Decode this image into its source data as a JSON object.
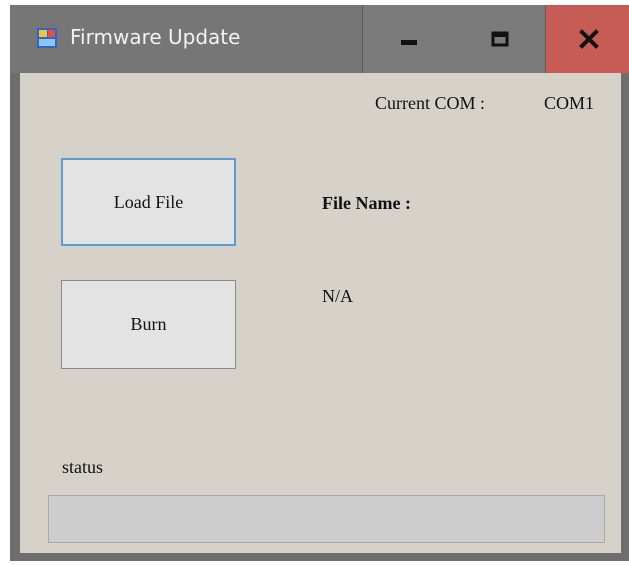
{
  "window": {
    "title": "Firmware Update",
    "controls": {
      "minimize": "minimize",
      "maximize": "maximize",
      "close": "close"
    }
  },
  "com": {
    "label": "Current COM :",
    "value": "COM1"
  },
  "buttons": {
    "load_file": "Load File",
    "burn": "Burn"
  },
  "file": {
    "label": "File Name :",
    "value": "N/A"
  },
  "status": {
    "label": "status",
    "progress": 0
  },
  "colors": {
    "titlebar": "#767676",
    "client": "#d6d2ca",
    "close_button": "#c75b55",
    "focus_border": "#5b9bd5"
  }
}
